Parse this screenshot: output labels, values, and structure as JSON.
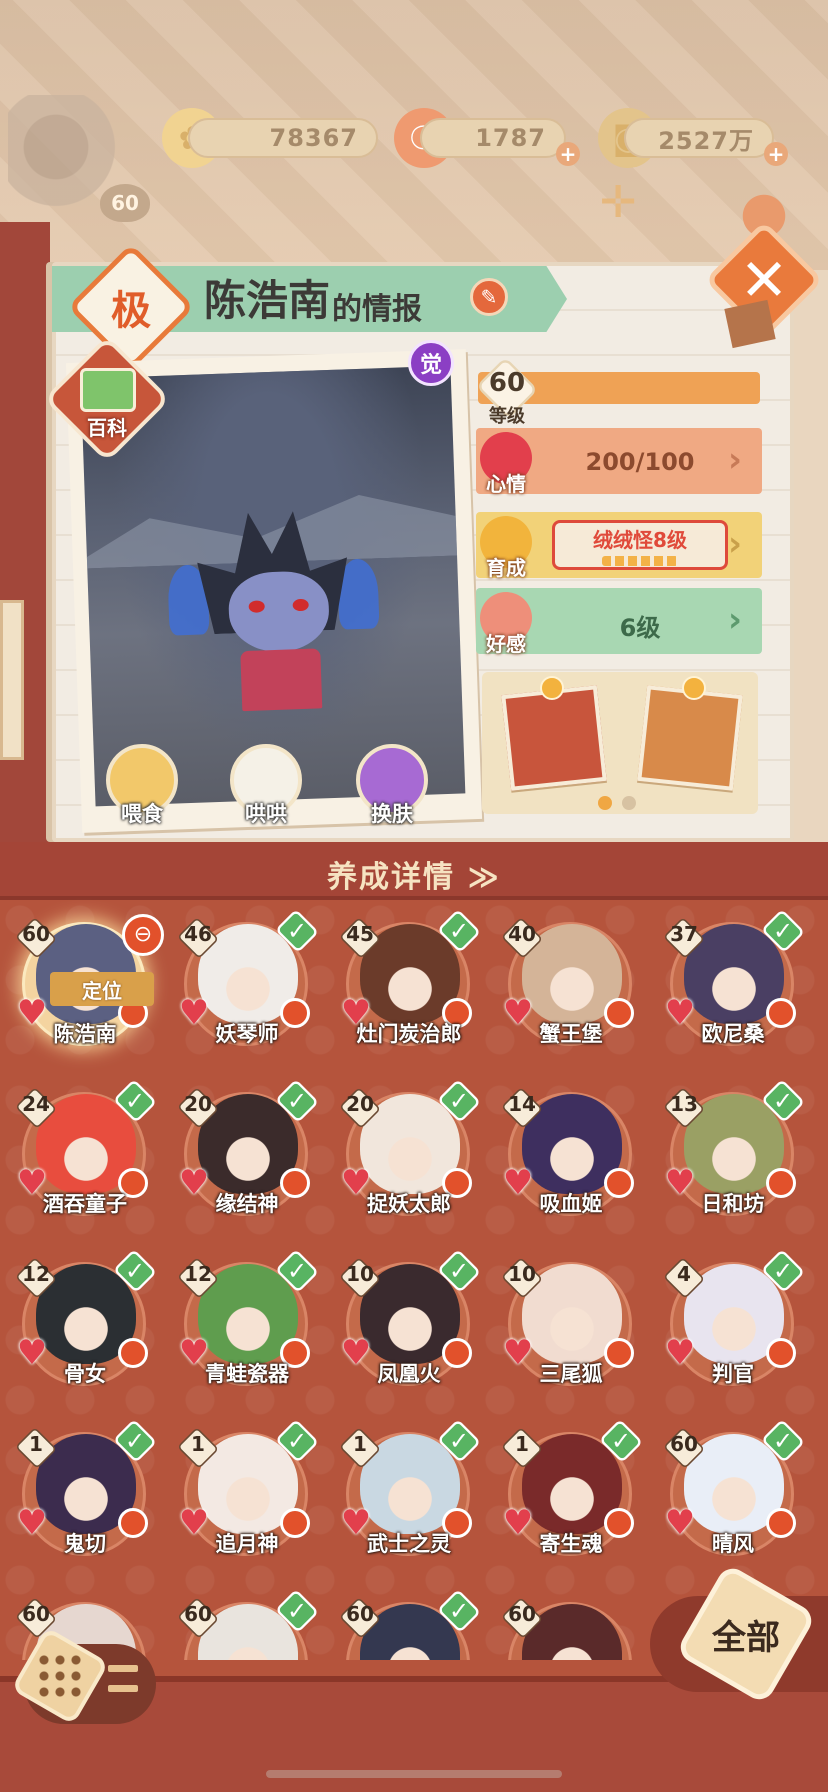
{
  "currencies": [
    {
      "name": "金币",
      "value": "78367",
      "icon": "chrysanthemum-coin-icon"
    },
    {
      "name": "勾玉",
      "value": "1787",
      "icon": "magatama-icon"
    },
    {
      "name": "铜钱",
      "value": "2527万",
      "icon": "copper-coin-icon"
    }
  ],
  "player_level": "60",
  "card": {
    "badge_char": "极",
    "name": "陈浩南",
    "title_suffix": "的情报",
    "wiki_label": "百科",
    "awakened_label": "觉",
    "level_value": "60",
    "level_label": "等级",
    "stats": [
      {
        "label": "心情",
        "value": "200/100",
        "icon": "heart-face-icon"
      },
      {
        "label": "育成",
        "value": "绒绒怪8级",
        "icon": "smile-icon"
      },
      {
        "label": "好感",
        "value": "6级",
        "icon": "flower-icon"
      }
    ],
    "actions": [
      {
        "label": "喂食",
        "icon": "noodle-bowl-icon"
      },
      {
        "label": "哄哄",
        "icon": "milk-carton-icon"
      },
      {
        "label": "换肤",
        "icon": "kimono-icon"
      }
    ],
    "gifts": [
      {
        "name": "hotpot",
        "icon": "hotpot-icon"
      },
      {
        "name": "wheel-frame",
        "icon": "wheel-frame-icon"
      }
    ]
  },
  "panel": {
    "title": "养成详情 ≫",
    "locate_label": "定位",
    "all_label": "全部",
    "characters": [
      {
        "name": "陈浩南",
        "level": "60",
        "checked": false,
        "color": "#5b6082"
      },
      {
        "name": "妖琴师",
        "level": "46",
        "checked": true,
        "color": "#f0ece8"
      },
      {
        "name": "灶门炭治郎",
        "level": "45",
        "checked": true,
        "color": "#6b3b2a"
      },
      {
        "name": "蟹王堡",
        "level": "40",
        "checked": false,
        "color": "#d4b498"
      },
      {
        "name": "欧尼桑",
        "level": "37",
        "checked": true,
        "color": "#4a3f63"
      },
      {
        "name": "酒吞童子",
        "level": "24",
        "checked": true,
        "color": "#e84d3e"
      },
      {
        "name": "缘结神",
        "level": "20",
        "checked": true,
        "color": "#3b2b2b"
      },
      {
        "name": "捉妖太郎",
        "level": "20",
        "checked": true,
        "color": "#f1e6dc"
      },
      {
        "name": "吸血姬",
        "level": "14",
        "checked": false,
        "color": "#3e2f5f"
      },
      {
        "name": "日和坊",
        "level": "13",
        "checked": true,
        "color": "#9aa064"
      },
      {
        "name": "骨女",
        "level": "12",
        "checked": true,
        "color": "#2b2f33"
      },
      {
        "name": "青蛙瓷器",
        "level": "12",
        "checked": true,
        "color": "#5f9d4e"
      },
      {
        "name": "凤凰火",
        "level": "10",
        "checked": true,
        "color": "#3a2a2e"
      },
      {
        "name": "三尾狐",
        "level": "10",
        "checked": false,
        "color": "#f1dcd0"
      },
      {
        "name": "判官",
        "level": "4",
        "checked": true,
        "color": "#e8e4ef"
      },
      {
        "name": "鬼切",
        "level": "1",
        "checked": true,
        "color": "#3c2c4e"
      },
      {
        "name": "追月神",
        "level": "1",
        "checked": true,
        "color": "#f3e9e3"
      },
      {
        "name": "武士之灵",
        "level": "1",
        "checked": true,
        "color": "#c9d8e2"
      },
      {
        "name": "寄生魂",
        "level": "1",
        "checked": true,
        "color": "#7a2a2a"
      },
      {
        "name": "晴风",
        "level": "60",
        "checked": true,
        "color": "#e9eef7"
      },
      {
        "name": "",
        "level": "60",
        "checked": false,
        "color": "#e6d7d0"
      },
      {
        "name": "",
        "level": "60",
        "checked": true,
        "color": "#e9e4de"
      },
      {
        "name": "",
        "level": "60",
        "checked": true,
        "color": "#343850"
      },
      {
        "name": "",
        "level": "60",
        "checked": false,
        "color": "#5a2a2a"
      }
    ]
  },
  "colors": {
    "accent_orange": "#e97a3c",
    "panel_red": "#b5543c",
    "check_green": "#58b462",
    "heart_red": "#e23f4c"
  }
}
